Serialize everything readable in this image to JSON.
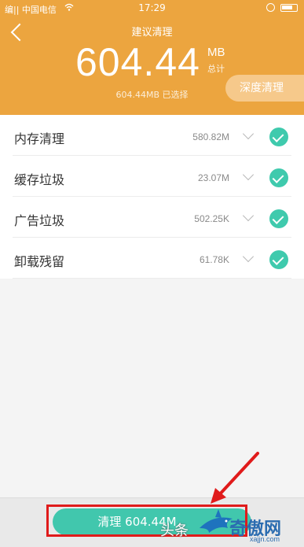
{
  "status_bar": {
    "carrier": "编|| 中国电信",
    "time": "17:29"
  },
  "header": {
    "title": "建议清理",
    "total_value": "604.44",
    "total_unit": "MB",
    "total_sub": "总计",
    "selected_text": "604.44MB 已选择",
    "deep_clean_label": "深度清理",
    "accent_color": "#eca53f"
  },
  "items": [
    {
      "label": "内存清理",
      "size": "580.82M",
      "checked": true
    },
    {
      "label": "缓存垃圾",
      "size": "23.07M",
      "checked": true
    },
    {
      "label": "广告垃圾",
      "size": "502.25K",
      "checked": true
    },
    {
      "label": "卸载残留",
      "size": "61.78K",
      "checked": true
    }
  ],
  "bottom": {
    "clean_button_label": "清理 604.44M",
    "button_color": "#41c7ad"
  },
  "watermark": {
    "left_text": "头条",
    "cn_text": "奇傲网",
    "url": "xajjn.com"
  },
  "icons": [
    "back-icon",
    "wifi-icon",
    "alarm-icon",
    "battery-icon",
    "chevron-down-icon",
    "checkmark-icon",
    "annotation-arrow"
  ]
}
